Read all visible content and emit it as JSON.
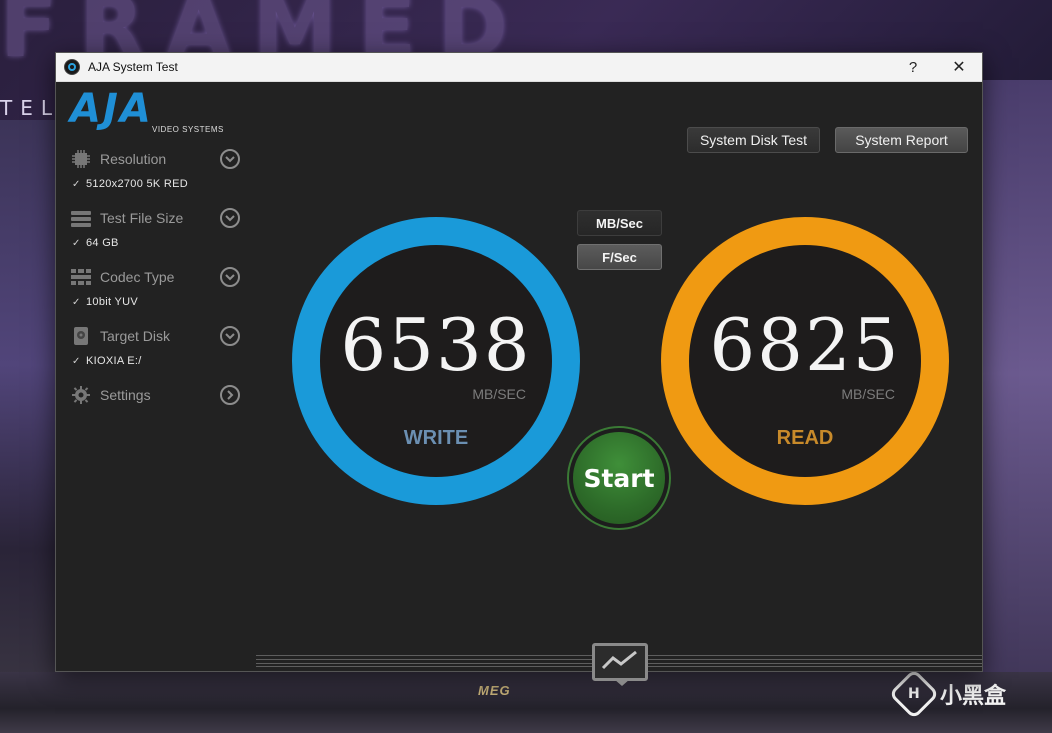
{
  "window": {
    "title": "AJA System Test",
    "help_label": "?",
    "close_label": "✕"
  },
  "logo": {
    "word": "AJA",
    "sub": "VIDEO SYSTEMS"
  },
  "sidebar": {
    "items": [
      {
        "label": "Resolution",
        "value": "5120x2700 5K RED",
        "icon": "chip-icon"
      },
      {
        "label": "Test File Size",
        "value": "64 GB",
        "icon": "stack-icon"
      },
      {
        "label": "Codec Type",
        "value": "10bit YUV",
        "icon": "grid-icon"
      },
      {
        "label": "Target Disk",
        "value": "KIOXIA E:/",
        "icon": "disk-icon"
      },
      {
        "label": "Settings",
        "icon": "gear-icon"
      }
    ],
    "check": "✓"
  },
  "buttons": {
    "disk_test": "System Disk Test",
    "report": "System Report"
  },
  "units": {
    "mb": "MB/Sec",
    "fs": "F/Sec"
  },
  "write": {
    "value": "6538",
    "unit": "MB/SEC",
    "label": "WRITE",
    "color": "#1a9ad9"
  },
  "read": {
    "value": "6825",
    "unit": "MB/SEC",
    "label": "READ",
    "color": "#f09a12"
  },
  "start": {
    "label": "Start"
  },
  "background": {
    "title": "FRAMED",
    "side": "TEL",
    "board": "MEG"
  },
  "watermark": {
    "text": "小黑盒",
    "logo": "H"
  }
}
